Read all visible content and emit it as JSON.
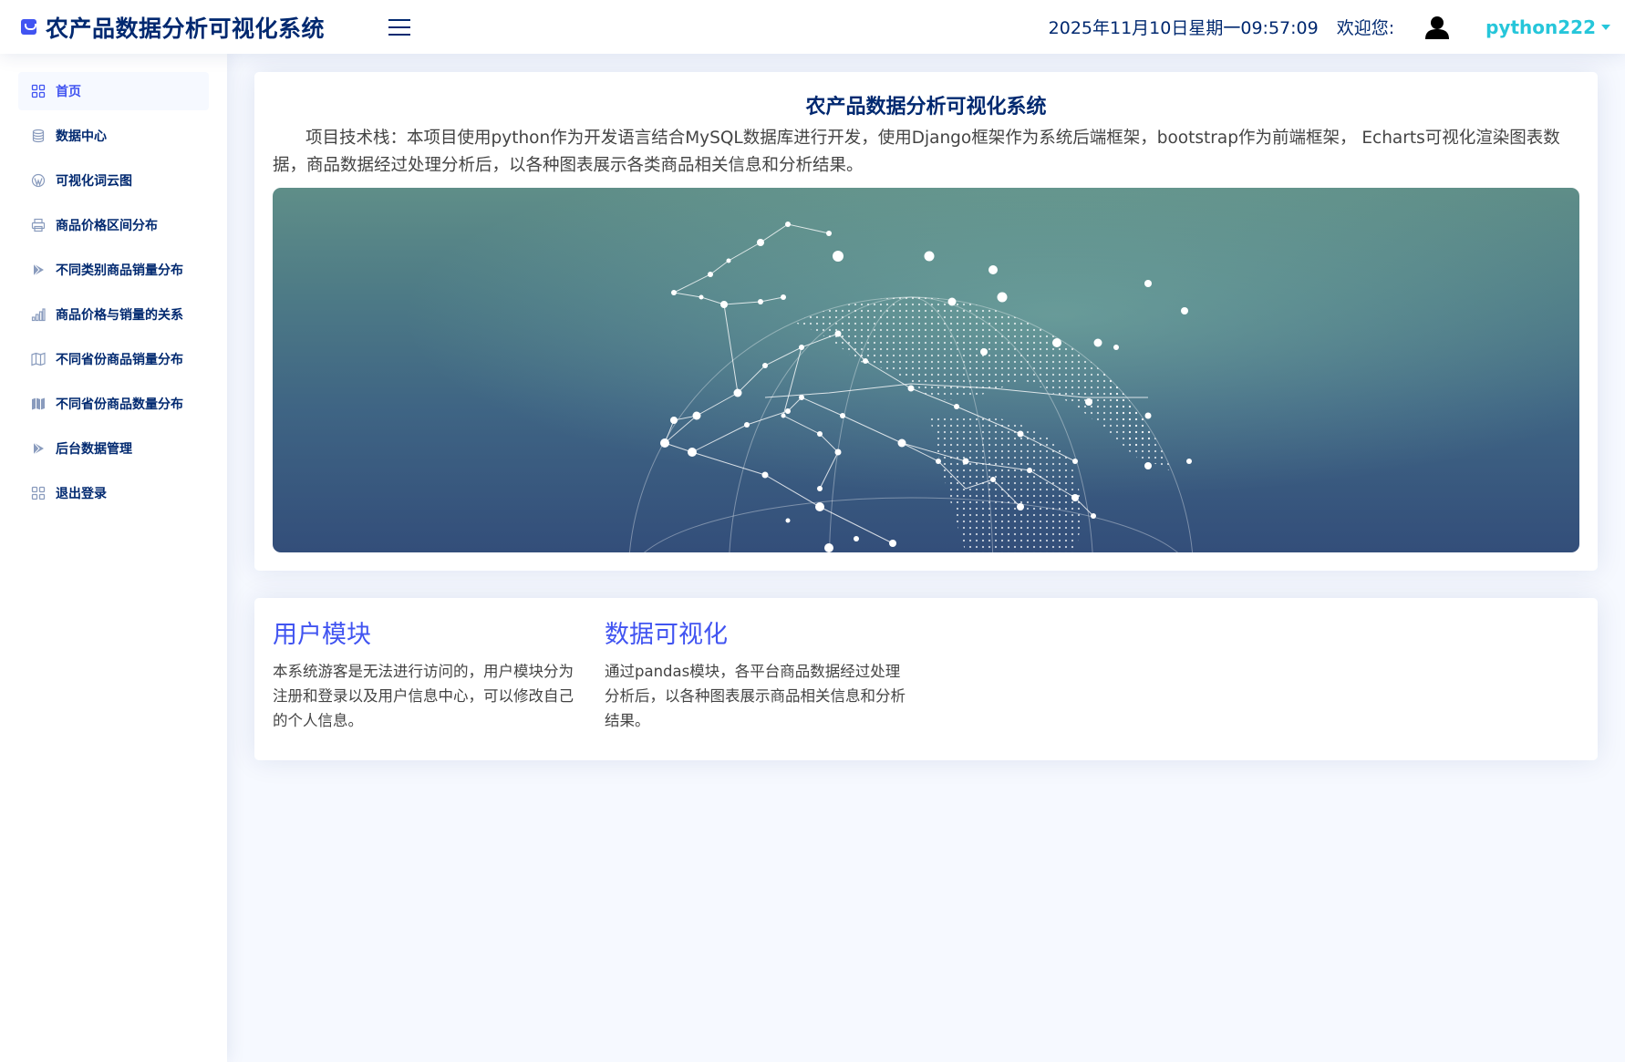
{
  "header": {
    "logo_text": "农产品数据分析可视化系统",
    "clock": "2025年11月10日星期一09:57:09",
    "welcome": "欢迎您:",
    "username": "python222"
  },
  "sidebar": {
    "items": [
      {
        "label": "首页",
        "icon": "grid-icon",
        "active": true
      },
      {
        "label": "数据中心",
        "icon": "database-icon"
      },
      {
        "label": "可视化词云图",
        "icon": "wordpress-icon"
      },
      {
        "label": "商品价格区间分布",
        "icon": "printer-icon"
      },
      {
        "label": "不同类别商品销量分布",
        "icon": "play-icon"
      },
      {
        "label": "商品价格与销量的关系",
        "icon": "bar-chart-icon"
      },
      {
        "label": "不同省份商品销量分布",
        "icon": "map-icon"
      },
      {
        "label": "不同省份商品数量分布",
        "icon": "map-fill-icon"
      },
      {
        "label": "后台数据管理",
        "icon": "play-icon"
      },
      {
        "label": "退出登录",
        "icon": "grid-icon"
      }
    ]
  },
  "hero": {
    "title": "农产品数据分析可视化系统",
    "description": "项目技术栈：本项目使用python作为开发语言结合MySQL数据库进行开发，使用Django框架作为系统后端框架，bootstrap作为前端框架， Echarts可视化渲染图表数据，商品数据经过处理分析后，以各种图表展示各类商品相关信息和分析结果。"
  },
  "modules": [
    {
      "title": "用户模块",
      "text": "本系统游客是无法进行访问的，用户模块分为注册和登录以及用户信息中心，可以修改自己的个人信息。"
    },
    {
      "title": "数据可视化",
      "text": "通过pandas模块，各平台商品数据经过处理分析后，以各种图表展示商品相关信息和分析结果。"
    }
  ],
  "colors": {
    "primary": "#4154f1",
    "navy": "#012970",
    "username": "#26c6da",
    "background": "#f6f9ff"
  }
}
